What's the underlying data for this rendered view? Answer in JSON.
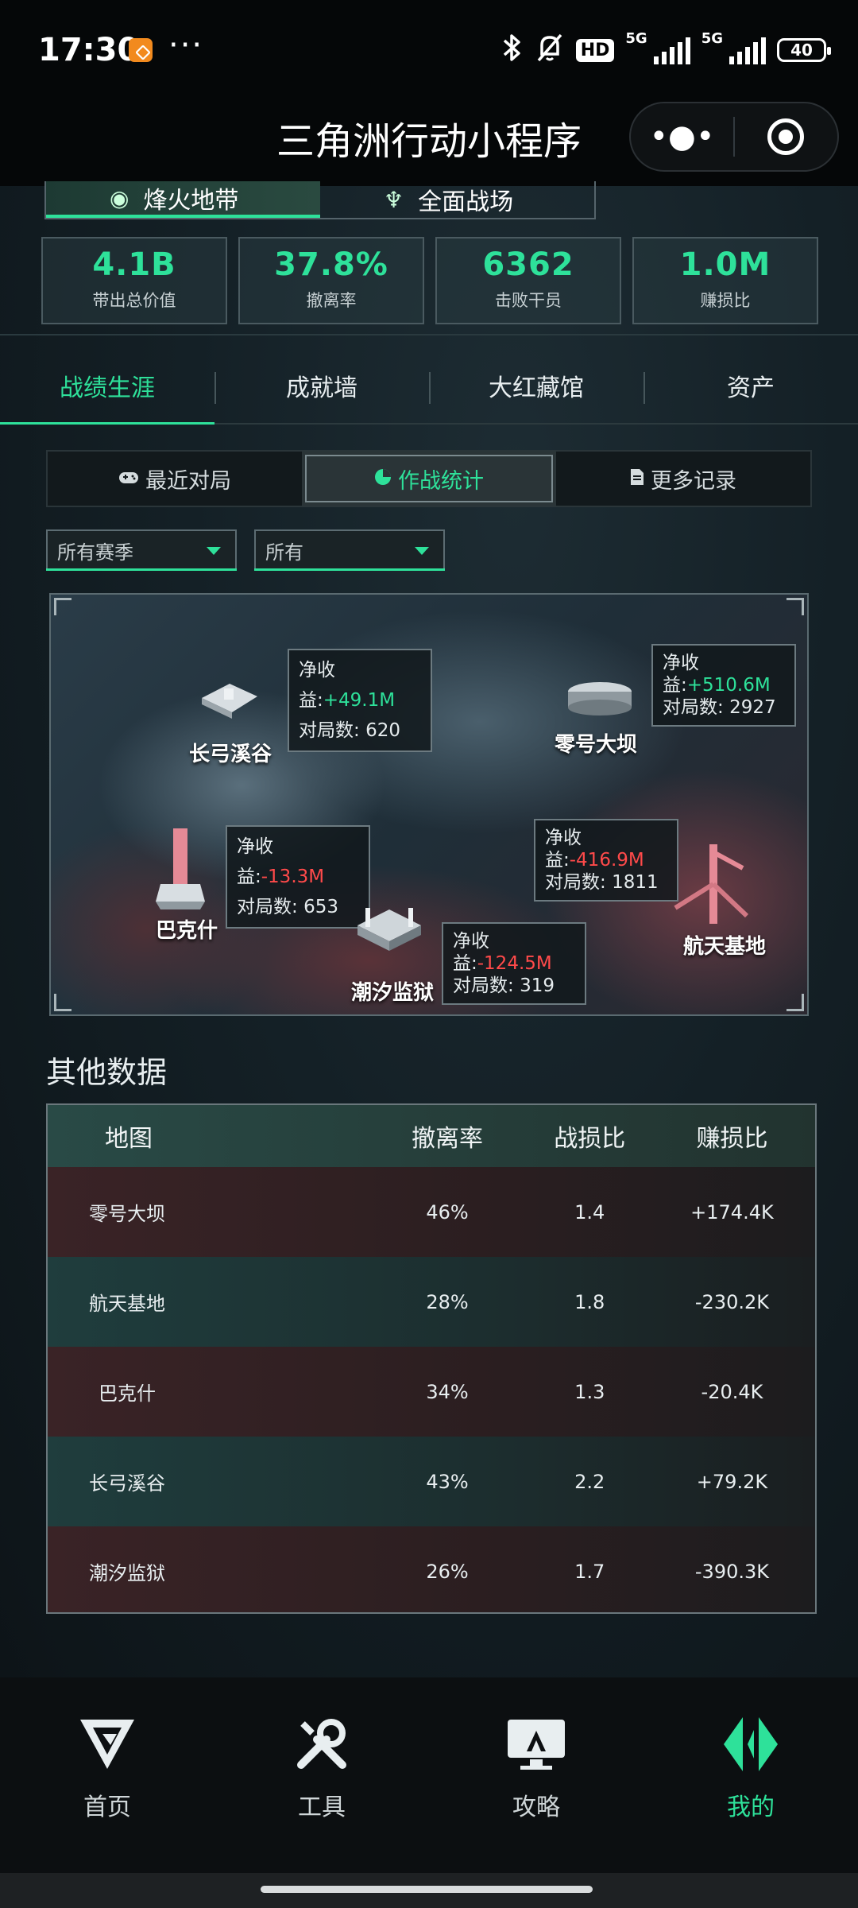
{
  "status_bar": {
    "time": "17:30",
    "more": "···",
    "hd": "HD",
    "network_1": "5G",
    "network_2": "5G",
    "battery": "40"
  },
  "title_bar": {
    "title": "三角洲行动小程序",
    "more_label": "•●•"
  },
  "mode_tabs": [
    {
      "label": "烽火地带",
      "active": true
    },
    {
      "label": "全面战场",
      "active": false
    }
  ],
  "stats": [
    {
      "value": "4.1B",
      "label": "带出总价值"
    },
    {
      "value": "37.8%",
      "label": "撤离率"
    },
    {
      "value": "6362",
      "label": "击败干员"
    },
    {
      "value": "1.0M",
      "label": "赚损比"
    }
  ],
  "section_tabs": [
    {
      "label": "战绩生涯",
      "active": true
    },
    {
      "label": "成就墙",
      "active": false
    },
    {
      "label": "大红藏馆",
      "active": false
    },
    {
      "label": "资产",
      "active": false
    }
  ],
  "sub_tabs": [
    {
      "label": "最近对局",
      "icon": "gamepad-icon",
      "active": false
    },
    {
      "label": "作战统计",
      "icon": "pie-chart-icon",
      "active": true
    },
    {
      "label": "更多记录",
      "icon": "document-icon",
      "active": false
    }
  ],
  "filters": {
    "season": "所有赛季",
    "mode": "所有"
  },
  "map": {
    "net_label": "净收益:",
    "net_label_a": "净收",
    "net_label_b": "益:",
    "matches_label": "对局数: ",
    "locations": [
      {
        "name": "长弓溪谷",
        "net": "+49.1M",
        "matches": "620"
      },
      {
        "name": "零号大坝",
        "net": "+510.6M",
        "matches": "2927"
      },
      {
        "name": "巴克什",
        "net": "-13.3M",
        "matches": "653"
      },
      {
        "name": "航天基地",
        "net": "-416.9M",
        "matches": "1811"
      },
      {
        "name": "潮汐监狱",
        "net": "-124.5M",
        "matches": "319"
      }
    ]
  },
  "other_data": {
    "title": "其他数据",
    "headers": [
      "地图",
      "撤离率",
      "战损比",
      "赚损比"
    ],
    "rows": [
      [
        "零号大坝",
        "46%",
        "1.4",
        "+174.4K"
      ],
      [
        "航天基地",
        "28%",
        "1.8",
        "-230.2K"
      ],
      [
        "巴克什",
        "34%",
        "1.3",
        "-20.4K"
      ],
      [
        "长弓溪谷",
        "43%",
        "2.2",
        "+79.2K"
      ],
      [
        "潮汐监狱",
        "26%",
        "1.7",
        "-390.3K"
      ]
    ]
  },
  "bottom_nav": [
    {
      "label": "首页",
      "icon": "home-logo-icon",
      "active": false
    },
    {
      "label": "工具",
      "icon": "tools-icon",
      "active": false
    },
    {
      "label": "攻略",
      "icon": "guide-icon",
      "active": false
    },
    {
      "label": "我的",
      "icon": "profile-logo-icon",
      "active": true
    }
  ],
  "colors": {
    "accent": "#2ee19a",
    "negative": "#ff4a4a"
  }
}
